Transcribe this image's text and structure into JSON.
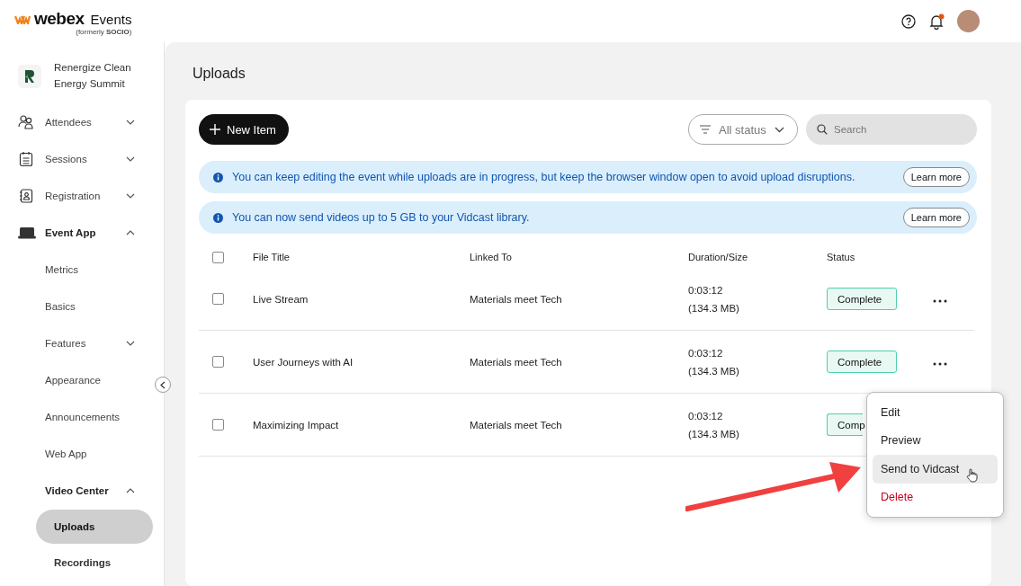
{
  "header": {
    "brand": "webex",
    "product": "Events",
    "formerly": "(formerly ",
    "formerly_brand": "SOCIO",
    "formerly_end": ")",
    "notifications_unread": true
  },
  "event": {
    "name": "Renergize Clean Energy Summit"
  },
  "sidebar": {
    "items": [
      {
        "label": "Attendees",
        "expanded": false,
        "selected": false
      },
      {
        "label": "Sessions",
        "expanded": false,
        "selected": false
      },
      {
        "label": "Registration",
        "expanded": false,
        "selected": false
      },
      {
        "label": "Event App",
        "expanded": true,
        "selected": false,
        "children": [
          {
            "label": "Metrics",
            "selected": false
          },
          {
            "label": "Basics",
            "selected": false
          },
          {
            "label": "Features",
            "expanded": false,
            "selected": false
          },
          {
            "label": "Appearance",
            "selected": false
          },
          {
            "label": "Announcements",
            "selected": false
          },
          {
            "label": "Web App",
            "selected": false
          },
          {
            "label": "Video Center",
            "expanded": true,
            "selected": false,
            "children": [
              {
                "label": "Uploads",
                "selected": true
              },
              {
                "label": "Recordings",
                "selected": false
              }
            ]
          }
        ]
      }
    ]
  },
  "page": {
    "title": "Uploads"
  },
  "toolbar": {
    "new_button": "New Item",
    "filter": "All status",
    "search": {
      "placeholder": "Search"
    }
  },
  "banners": [
    {
      "text": "You can keep editing the event while uploads are in progress, but keep the browser window open to avoid upload disruptions.",
      "action": "Learn more"
    },
    {
      "text": "You can now send videos up to 5 GB to your Vidcast library.",
      "action": "Learn more"
    }
  ],
  "table": {
    "select_all": {
      "checked": false
    },
    "columns": [
      "File Title",
      "Linked To",
      "Duration/Size",
      "Status"
    ],
    "rows": [
      {
        "checked": false,
        "title": "Live Stream",
        "linked_to": "Materials meet Tech",
        "duration": "0:03:12",
        "size": "(134.3 MB)",
        "status": "Complete"
      },
      {
        "checked": false,
        "title": "User Journeys with AI",
        "linked_to": "Materials meet Tech",
        "duration": "0:03:12",
        "size": "(134.3 MB)",
        "status": "Complete"
      },
      {
        "checked": false,
        "title": "Maximizing Impact",
        "linked_to": "Materials meet Tech",
        "duration": "0:03:12",
        "size": "(134.3 MB)",
        "status": "Comp"
      }
    ]
  },
  "context_menu": {
    "items": [
      {
        "label": "Edit",
        "kind": "normal",
        "selected": false
      },
      {
        "label": "Preview",
        "kind": "normal",
        "selected": false
      },
      {
        "label": "Send to Vidcast",
        "kind": "normal",
        "selected": true
      },
      {
        "label": "Delete",
        "kind": "danger",
        "selected": false
      }
    ]
  }
}
